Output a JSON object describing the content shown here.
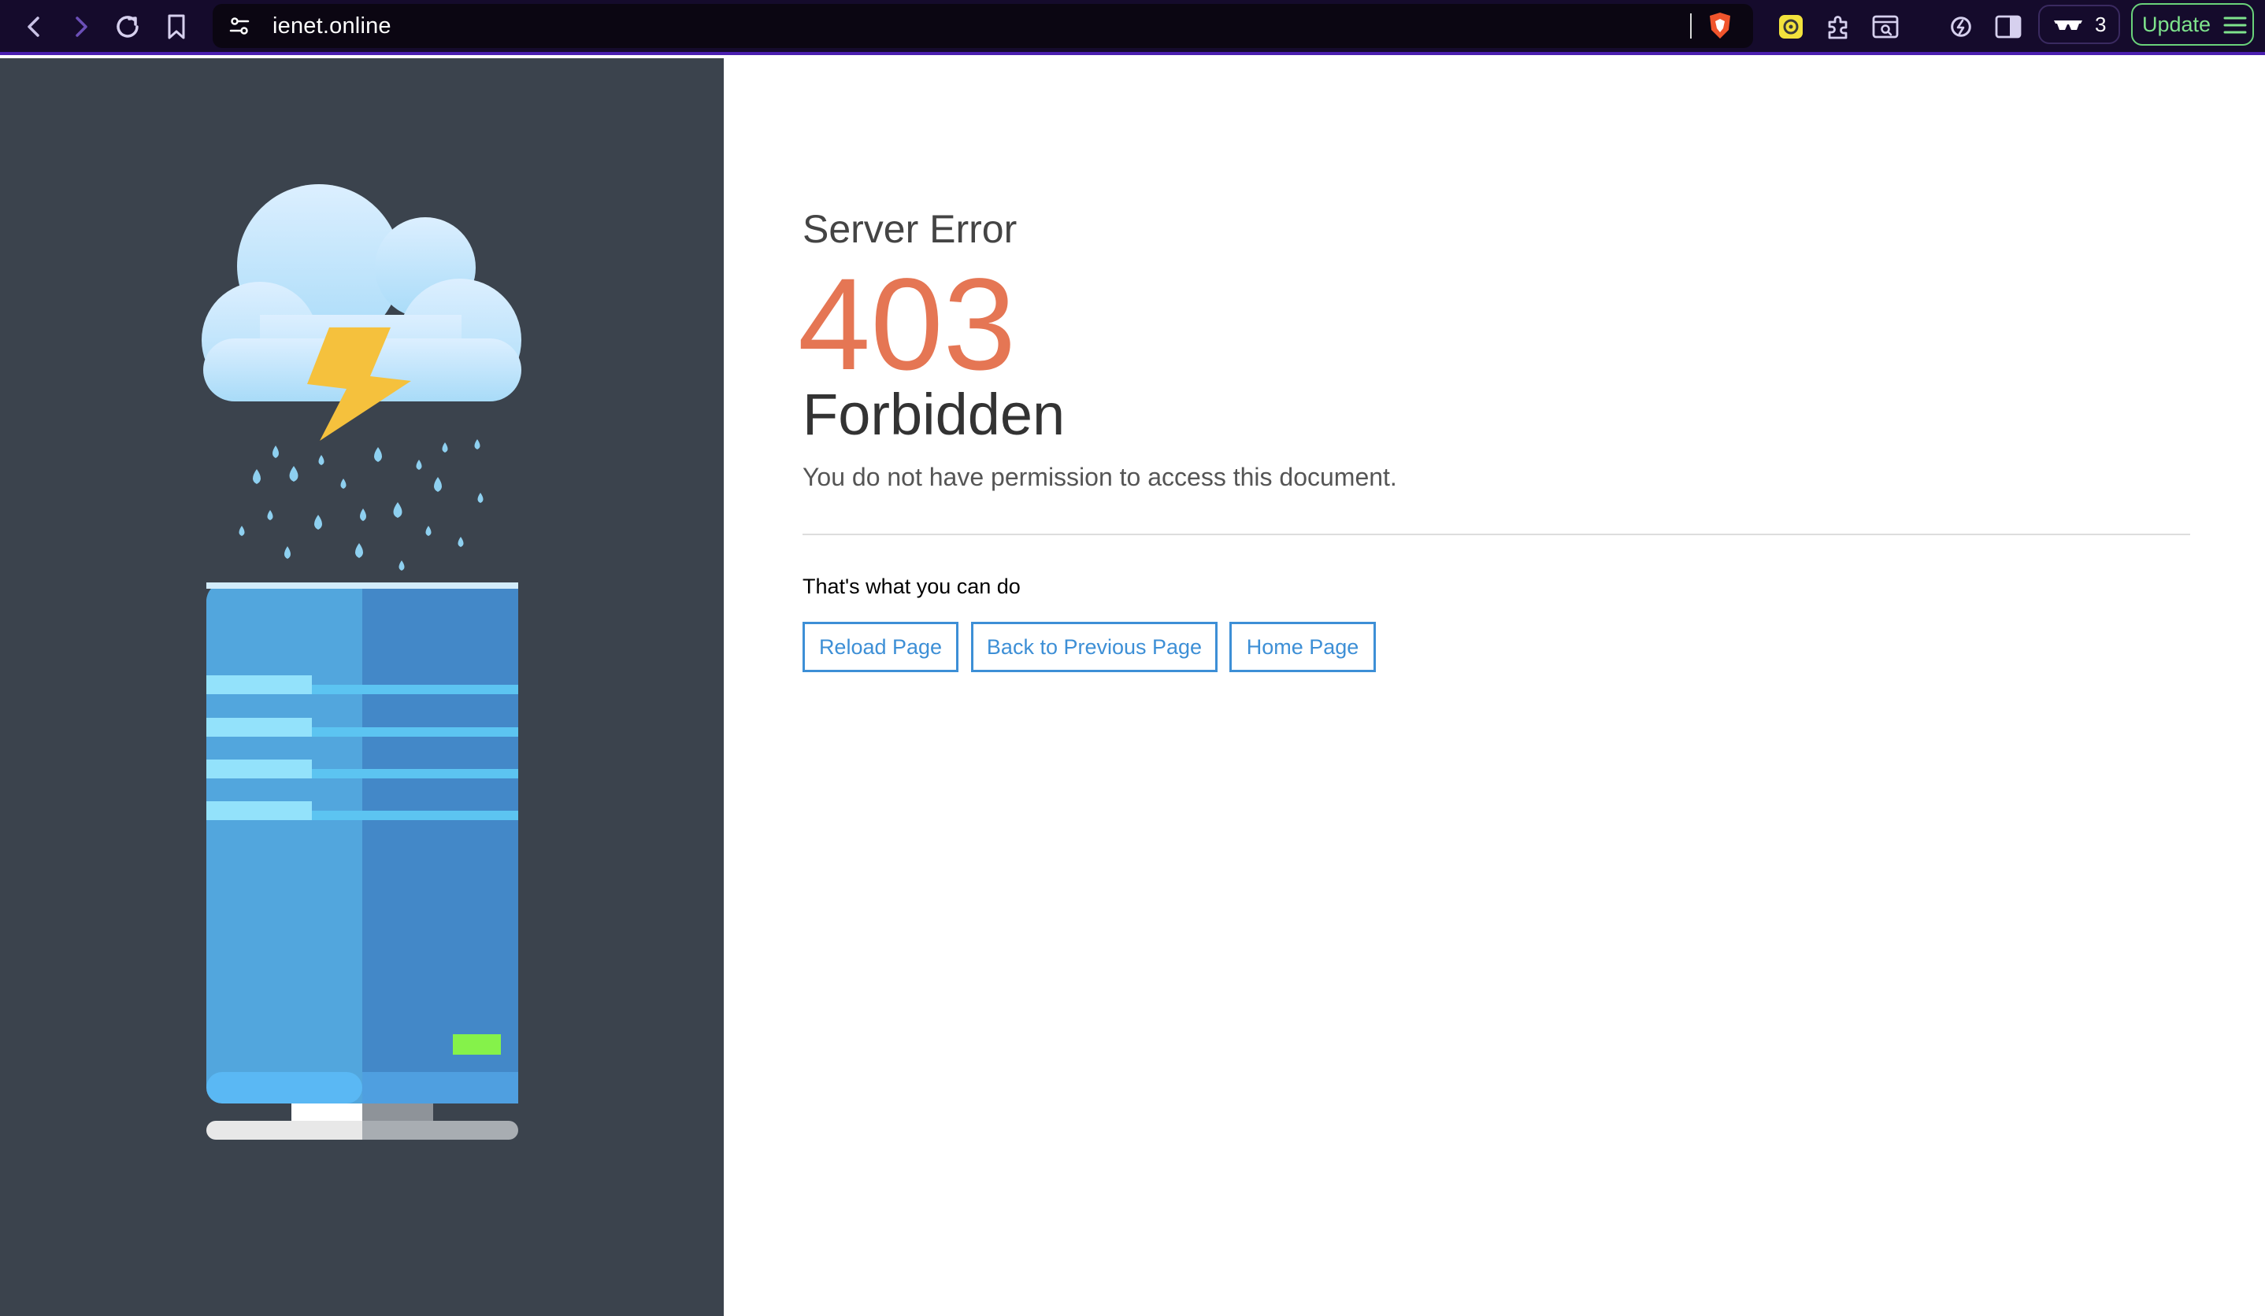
{
  "browser": {
    "url": "ienet.online",
    "vpn_count": "3",
    "update_label": "Update",
    "icons": [
      "back-icon",
      "forward-icon",
      "reload-icon",
      "bookmark-icon",
      "site-settings-icon",
      "brave-shield-icon",
      "extension-yellow-icon",
      "extensions-puzzle-icon",
      "reader-mode-icon",
      "leo-icon",
      "sidebar-icon",
      "vpn-glasses-icon",
      "menu-icon"
    ]
  },
  "page": {
    "subtitle": "Server Error",
    "code": "403",
    "title": "Forbidden",
    "description": "You do not have permission to access this document.",
    "hint": "That's what you can do",
    "actions": {
      "reload": "Reload Page",
      "back": "Back to Previous Page",
      "home": "Home Page"
    }
  },
  "colors": {
    "toolbar_bg": "#150b2c",
    "left_panel_bg": "#3b434d",
    "error_code": "#e57654",
    "button_border": "#3d8fd6"
  }
}
